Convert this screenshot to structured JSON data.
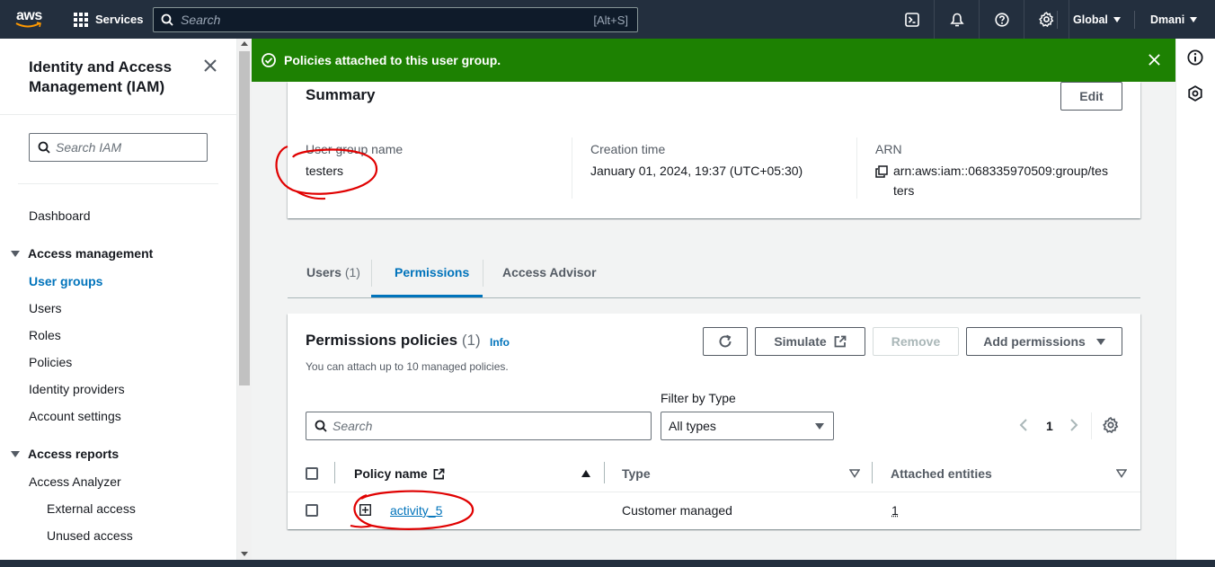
{
  "topnav": {
    "logo_text": "aws",
    "services_label": "Services",
    "search_placeholder": "Search",
    "search_shortcut": "[Alt+S]",
    "region_label": "Global",
    "user_label": "Dmani",
    "icons": [
      "cloudshell-icon",
      "bell-icon",
      "help-icon",
      "settings-icon"
    ]
  },
  "sidebar": {
    "title": "Identity and Access Management (IAM)",
    "search_placeholder": "Search IAM",
    "dashboard": "Dashboard",
    "section_access_management": "Access management",
    "items_management": [
      "User groups",
      "Users",
      "Roles",
      "Policies",
      "Identity providers",
      "Account settings"
    ],
    "active_item": "User groups",
    "section_access_reports": "Access reports",
    "access_analyzer": "Access Analyzer",
    "analyzer_subitems": [
      "External access",
      "Unused access"
    ]
  },
  "flash": {
    "message": "Policies attached to this user group.",
    "color": "#1d8102"
  },
  "summary": {
    "title": "Summary",
    "edit_label": "Edit",
    "group_name_label": "User group name",
    "group_name_value": "testers",
    "creation_label": "Creation time",
    "creation_value": "January 01, 2024, 19:37 (UTC+05:30)",
    "arn_label": "ARN",
    "arn_line1": "arn:aws:iam::068335970509:group/tes",
    "arn_line2": "ters"
  },
  "tabs": [
    {
      "label": "Users",
      "count": "(1)"
    },
    {
      "label": "Permissions",
      "count": ""
    },
    {
      "label": "Access Advisor",
      "count": ""
    }
  ],
  "permissions": {
    "heading": "Permissions policies",
    "count": "(1)",
    "info_label": "Info",
    "description": "You can attach up to 10 managed policies.",
    "refresh_icon": "refresh-icon",
    "simulate_label": "Simulate",
    "remove_label": "Remove",
    "add_label": "Add permissions",
    "search_placeholder": "Search",
    "filter_label": "Filter by Type",
    "filter_value": "All types",
    "page_number": "1",
    "columns": [
      "Policy name",
      "Type",
      "Attached entities"
    ],
    "rows": [
      {
        "name": "activity_5",
        "type": "Customer managed",
        "entities": "1"
      }
    ]
  },
  "accent_color": "#0073bb",
  "annotation_color": "#e00000"
}
